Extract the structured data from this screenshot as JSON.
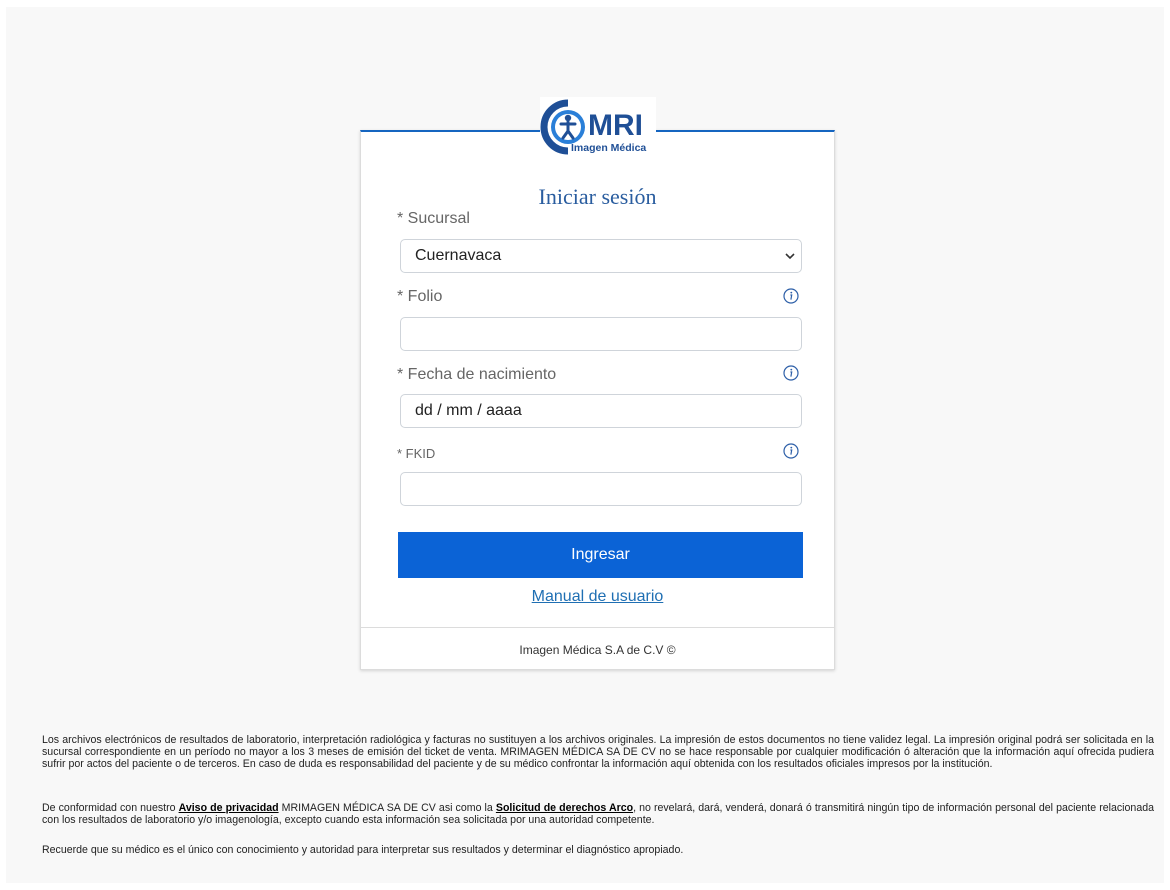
{
  "logo": {
    "brand": "MRI",
    "tagline": "Imagen Médica"
  },
  "login": {
    "title": "Iniciar sesión",
    "sucursal_label": "* Sucursal",
    "sucursal_value": "Cuernavaca",
    "folio_label": "* Folio",
    "folio_value": "",
    "fecha_label": "* Fecha de nacimiento",
    "fecha_placeholder": "dd / mm / aaaa",
    "fkid_label": "* FKID",
    "fkid_value": "",
    "submit_label": "Ingresar",
    "manual_link": "Manual de usuario",
    "footer": "Imagen Médica S.A de C.V ©"
  },
  "disclaimer": {
    "paragraph1": "Los archivos electrónicos de resultados de laboratorio, interpretación radiológica y facturas no sustituyen a los archivos originales. La impresión de estos documentos no tiene validez legal. La impresión original podrá ser solicitada en la sucursal correspondiente en un período no mayor a los 3 meses de emisión del ticket de venta. MRIMAGEN MÉDICA SA DE CV no se hace responsable por cualquier modificación ó alteración que la información aquí ofrecida pudiera sufrir por actos del paciente o de terceros. En caso de duda es responsabilidad del paciente y de su médico confrontar la información aquí obtenida con los resultados oficiales impresos por la institución.",
    "p2_before": "De conformidad con nuestro ",
    "privacy_link": "Aviso de privacidad",
    "p2_middle": " MRIMAGEN MÉDICA SA DE CV asi como la ",
    "arco_link": "Solicitud de derechos Arco",
    "p2_after": ", no revelará, dará, venderá, donará ó transmitirá ningún tipo de información personal del paciente relacionada con los resultados de laboratorio y/o imagenología, excepto cuando esta información sea solicitada por una autoridad competente.",
    "paragraph3": "Recuerde que su médico es el único con conocimiento y autoridad para interpretar sus resultados y determinar el diagnóstico apropiado."
  },
  "colors": {
    "accent": "#0b63d6",
    "title": "#2a5d9f",
    "link": "#1f6fb3"
  }
}
